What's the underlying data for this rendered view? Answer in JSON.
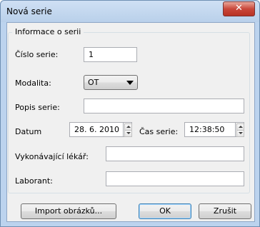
{
  "window": {
    "title": "Nová serie",
    "close_icon": "close-icon"
  },
  "group": {
    "title": "Informace o serii"
  },
  "fields": {
    "cislo_serie": {
      "label": "Číslo serie:",
      "value": "1"
    },
    "modalita": {
      "label": "Modalita:",
      "value": "OT"
    },
    "popis_serie": {
      "label": "Popis serie:",
      "value": ""
    },
    "datum": {
      "label": "Datum",
      "value": "28.  6. 2010"
    },
    "cas_serie": {
      "label": "Čas serie:",
      "value": "12:38:50"
    },
    "vykonavajici_lekar": {
      "label": "Vykonávající lékář:",
      "value": ""
    },
    "laborant": {
      "label": "Laborant:",
      "value": ""
    }
  },
  "buttons": {
    "import": "Import obrázků...",
    "ok": "OK",
    "cancel": "Zrušit"
  }
}
